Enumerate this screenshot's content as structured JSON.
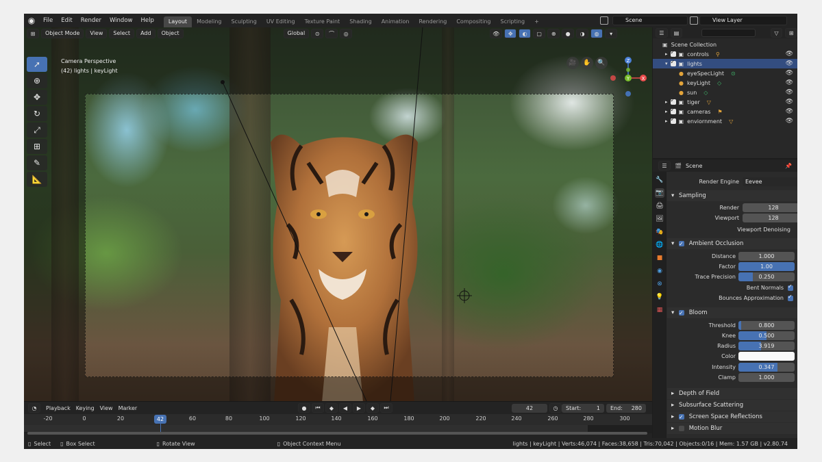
{
  "topbar": {
    "menus": [
      "File",
      "Edit",
      "Render",
      "Window",
      "Help"
    ],
    "workspaces": [
      "Layout",
      "Modeling",
      "Sculpting",
      "UV Editing",
      "Texture Paint",
      "Shading",
      "Animation",
      "Rendering",
      "Compositing",
      "Scripting"
    ],
    "active_workspace": "Layout",
    "scene": "Scene",
    "view_layer": "View Layer"
  },
  "viewport": {
    "mode": "Object Mode",
    "menus": [
      "View",
      "Select",
      "Add",
      "Object"
    ],
    "orientation": "Global",
    "info_line1": "Camera Perspective",
    "info_line2": "(42) lights | keyLight",
    "gizmo": {
      "z": "Z",
      "y": "Y",
      "x": "X"
    }
  },
  "timeline": {
    "menus": [
      "Playback",
      "Keying",
      "View",
      "Marker"
    ],
    "current_frame": "42",
    "start_label": "Start:",
    "start": "1",
    "end_label": "End:",
    "end": "280",
    "ticks": [
      "-20",
      "0",
      "20",
      "42",
      "60",
      "80",
      "100",
      "120",
      "140",
      "160",
      "180",
      "200",
      "220",
      "240",
      "260",
      "280",
      "300"
    ]
  },
  "status": {
    "select": "Select",
    "box_select": "Box Select",
    "rotate": "Rotate View",
    "context": "Object Context Menu",
    "stats": "lights | keyLight | Verts:46,074 | Faces:38,658 | Tris:70,042 | Objects:0/16 | Mem: 1.57 GB | v2.80.74"
  },
  "outliner": {
    "root": "Scene Collection",
    "items": [
      {
        "label": "controls",
        "level": 1,
        "selected": false
      },
      {
        "label": "lights",
        "level": 1,
        "selected": true
      },
      {
        "label": "eyeSpecLight",
        "level": 2,
        "selected": false
      },
      {
        "label": "keyLight",
        "level": 2,
        "selected": false
      },
      {
        "label": "sun",
        "level": 2,
        "selected": false
      },
      {
        "label": "tiger",
        "level": 1,
        "selected": false
      },
      {
        "label": "cameras",
        "level": 1,
        "selected": false
      },
      {
        "label": "enviornment",
        "level": 1,
        "selected": false
      }
    ]
  },
  "properties": {
    "header": "Scene",
    "render_engine_label": "Render Engine",
    "render_engine": "Eevee",
    "sampling": {
      "title": "Sampling",
      "render_label": "Render",
      "render": "128",
      "viewport_label": "Viewport",
      "viewport": "128",
      "denoise_label": "Viewport Denoising"
    },
    "ao": {
      "title": "Ambient Occlusion",
      "distance_label": "Distance",
      "distance": "1.000",
      "factor_label": "Factor",
      "factor": "1.00",
      "factor_fill": 1.0,
      "trace_label": "Trace Precision",
      "trace": "0.250",
      "trace_fill": 0.25,
      "bent_label": "Bent Normals",
      "bounce_label": "Bounces Approximation"
    },
    "bloom": {
      "title": "Bloom",
      "threshold_label": "Threshold",
      "threshold": "0.800",
      "knee_label": "Knee",
      "knee": "0.500",
      "knee_fill": 0.5,
      "radius_label": "Radius",
      "radius": "3.919",
      "radius_fill": 0.4,
      "color_label": "Color",
      "intensity_label": "Intensity",
      "intensity": "0.347",
      "intensity_fill": 0.7,
      "clamp_label": "Clamp",
      "clamp": "1.000"
    },
    "sections": [
      "Depth of Field",
      "Subsurface Scattering",
      "Screen Space Reflections",
      "Motion Blur"
    ]
  },
  "colors": {
    "accent": "#4772b3",
    "selected_row": "#334d80"
  }
}
